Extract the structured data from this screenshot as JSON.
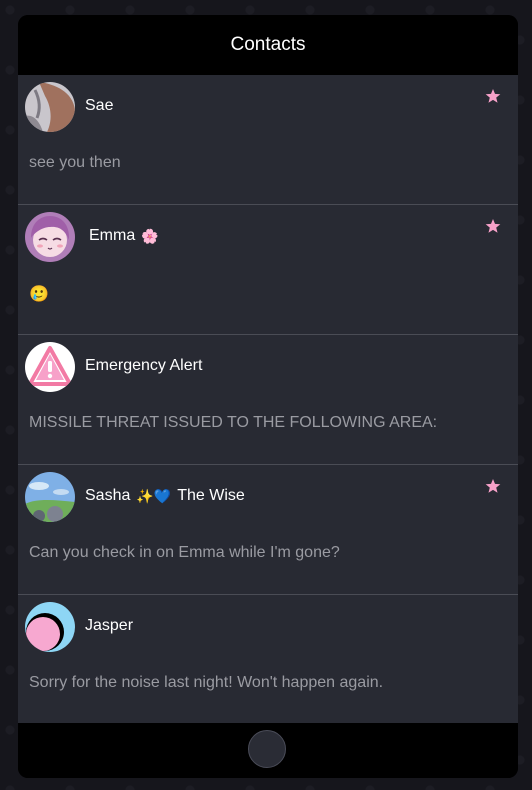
{
  "header": {
    "title": "Contacts"
  },
  "contacts": [
    {
      "name": "Sae",
      "name_suffix": "",
      "name_extra": "",
      "favorite": true,
      "avatar": "brown-figure-avatar",
      "preview": "see you then"
    },
    {
      "name": "Emma",
      "name_suffix": "🌸",
      "name_extra": "",
      "favorite": true,
      "avatar": "anime-girl-avatar",
      "preview": "🥲"
    },
    {
      "name": "Emergency Alert",
      "name_suffix": "",
      "name_extra": "",
      "favorite": false,
      "avatar": "warning-triangle-avatar",
      "preview": "MISSILE THREAT ISSUED TO THE FOLLOWING AREA:"
    },
    {
      "name": "Sasha",
      "name_suffix": "✨💙",
      "name_extra": "The Wise",
      "favorite": true,
      "avatar": "landscape-avatar",
      "preview": "Can you check in on Emma while I'm gone?"
    },
    {
      "name": "Jasper",
      "name_suffix": "",
      "name_extra": "",
      "favorite": false,
      "avatar": "pink-circle-avatar",
      "preview": "Sorry for the noise last night! Won't happen again."
    }
  ],
  "colors": {
    "accent_star": "#f7a1c9",
    "list_background": "#282a33",
    "preview_text": "#9a9ba2"
  }
}
